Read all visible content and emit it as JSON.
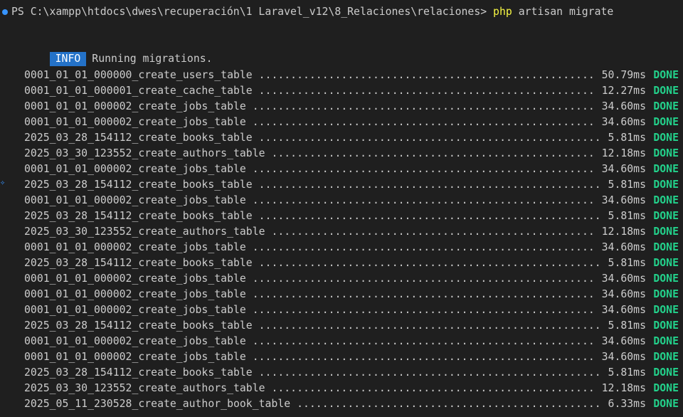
{
  "prompt": {
    "path": "PS C:\\xampp\\htdocs\\dwes\\recuperación\\1 Laravel_v12\\8_Relaciones\\relaciones> ",
    "command_php": "php",
    "command_rest": " artisan migrate"
  },
  "info": {
    "badge": "INFO",
    "message": "Running migrations."
  },
  "migrations": [
    {
      "name": "0001_01_01_000000_create_users_table",
      "time": "50.79ms",
      "status": "DONE"
    },
    {
      "name": "0001_01_01_000001_create_cache_table",
      "time": "12.27ms",
      "status": "DONE"
    },
    {
      "name": "0001_01_01_000002_create_jobs_table",
      "time": "34.60ms",
      "status": "DONE"
    },
    {
      "name": "0001_01_01_000002_create_jobs_table",
      "time": "34.60ms",
      "status": "DONE"
    },
    {
      "name": "2025_03_28_154112_create_books_table",
      "time": "5.81ms",
      "status": "DONE"
    },
    {
      "name": "2025_03_30_123552_create_authors_table",
      "time": "12.18ms",
      "status": "DONE"
    },
    {
      "name": "0001_01_01_000002_create_jobs_table",
      "time": "34.60ms",
      "status": "DONE"
    },
    {
      "name": "2025_03_28_154112_create_books_table",
      "time": "5.81ms",
      "status": "DONE"
    },
    {
      "name": "0001_01_01_000002_create_jobs_table",
      "time": "34.60ms",
      "status": "DONE"
    },
    {
      "name": "2025_03_28_154112_create_books_table",
      "time": "5.81ms",
      "status": "DONE"
    },
    {
      "name": "2025_03_30_123552_create_authors_table",
      "time": "12.18ms",
      "status": "DONE"
    },
    {
      "name": "0001_01_01_000002_create_jobs_table",
      "time": "34.60ms",
      "status": "DONE"
    },
    {
      "name": "2025_03_28_154112_create_books_table",
      "time": "5.81ms",
      "status": "DONE"
    },
    {
      "name": "0001_01_01_000002_create_jobs_table",
      "time": "34.60ms",
      "status": "DONE"
    },
    {
      "name": "0001_01_01_000002_create_jobs_table",
      "time": "34.60ms",
      "status": "DONE"
    },
    {
      "name": "0001_01_01_000002_create_jobs_table",
      "time": "34.60ms",
      "status": "DONE"
    },
    {
      "name": "2025_03_28_154112_create_books_table",
      "time": "5.81ms",
      "status": "DONE"
    },
    {
      "name": "0001_01_01_000002_create_jobs_table",
      "time": "34.60ms",
      "status": "DONE"
    },
    {
      "name": "0001_01_01_000002_create_jobs_table",
      "time": "34.60ms",
      "status": "DONE"
    },
    {
      "name": "2025_03_28_154112_create_books_table",
      "time": "5.81ms",
      "status": "DONE"
    },
    {
      "name": "2025_03_30_123552_create_authors_table",
      "time": "12.18ms",
      "status": "DONE"
    },
    {
      "name": "2025_05_11_230528_create_author_book_table",
      "time": "6.33ms",
      "status": "DONE"
    }
  ],
  "colors": {
    "background": "#1f1f1f",
    "text": "#cccccc",
    "command": "#f5f543",
    "info_badge": "#2472c8",
    "done": "#23d18b",
    "prompt_dot": "#3794ff"
  },
  "icons": {
    "prompt_marker": "command-decoration-dot-icon",
    "side_marker": "sparkle-icon"
  }
}
